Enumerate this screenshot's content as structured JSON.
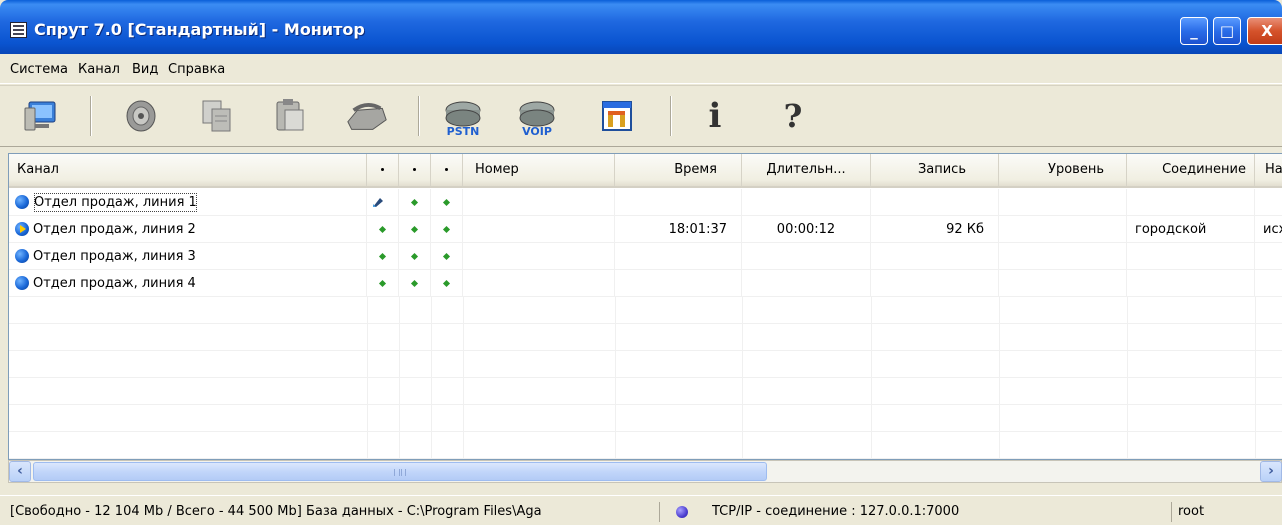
{
  "window": {
    "title": "Спрут 7.0 [Стандартный] - Монитор",
    "controls": {
      "minimize": "_",
      "maximize": "□",
      "close": "X"
    }
  },
  "menu": [
    "Система",
    "Канал",
    "Вид",
    "Справка"
  ],
  "toolbar": {
    "buttons": [
      {
        "icon": "computer-network-icon"
      },
      {
        "icon": "speaker-icon"
      },
      {
        "icon": "copy-icon"
      },
      {
        "icon": "paste-icon"
      },
      {
        "icon": "telephone-icon"
      },
      {
        "icon": "pstn-router-icon",
        "label": "PSTN"
      },
      {
        "icon": "voip-router-icon",
        "label": "VOIP"
      },
      {
        "icon": "settings-window-icon"
      },
      {
        "icon": "info-icon",
        "label": "i"
      },
      {
        "icon": "help-icon",
        "label": "?"
      }
    ]
  },
  "table": {
    "columns": [
      "Канал",
      "•",
      "•",
      "•",
      "Номер",
      "Время",
      "Длительн...",
      "Запись",
      "Уровень",
      "Соединение",
      "На"
    ],
    "rows": [
      {
        "channel": "Отдел продаж, линия 1",
        "state": "idle",
        "time": "",
        "duration": "",
        "record": "",
        "level": "",
        "connection": "",
        "direction": ""
      },
      {
        "channel": "Отдел продаж, линия 2",
        "state": "active",
        "time": "18:01:37",
        "duration": "00:00:12",
        "record": "92 Кб",
        "level": "",
        "connection": "городской",
        "direction": "исх"
      },
      {
        "channel": "Отдел продаж, линия 3",
        "state": "idle",
        "time": "",
        "duration": "",
        "record": "",
        "level": "",
        "connection": "",
        "direction": ""
      },
      {
        "channel": "Отдел продаж, линия 4",
        "state": "idle",
        "time": "",
        "duration": "",
        "record": "",
        "level": "",
        "connection": "",
        "direction": ""
      }
    ]
  },
  "status": {
    "disk": "[Свободно - 12 104  Mb / Всего - 44 500  Mb] База данных - C:\\Program Files\\Aga",
    "connection": "TCP/IP - соединение : 127.0.0.1:7000",
    "user": "root"
  },
  "colors": {
    "title_bar": "#0a54d0",
    "indicator_green": "#2a9a2a",
    "status_dot": "#4c3fd0"
  }
}
